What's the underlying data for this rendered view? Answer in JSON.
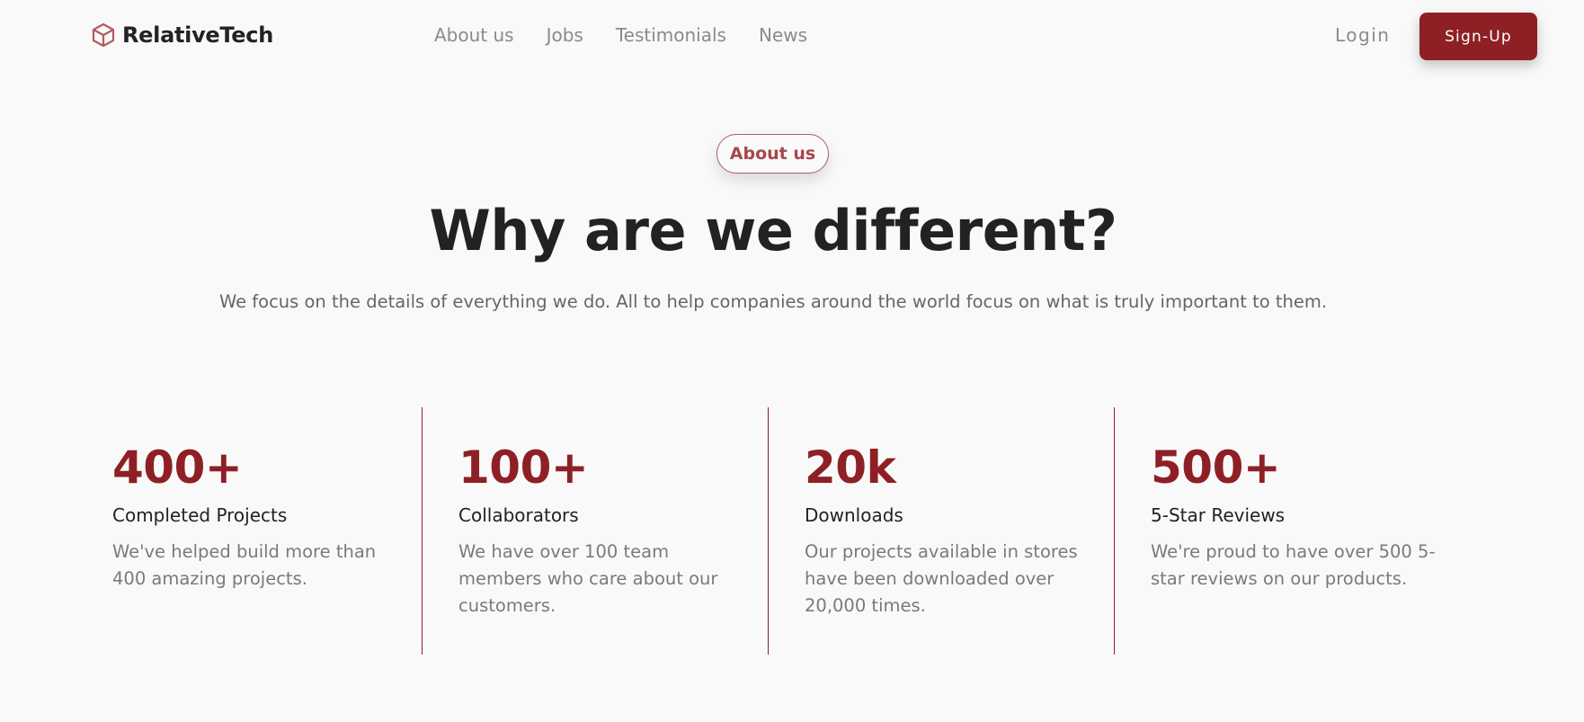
{
  "brand": {
    "name": "RelativeTech",
    "logo_icon": "cube-icon",
    "accent_color": "#8e2025"
  },
  "nav": {
    "links": [
      "About us",
      "Jobs",
      "Testimonials",
      "News"
    ],
    "login_label": "Login",
    "signup_label": "Sign-Up"
  },
  "hero": {
    "badge": "About us",
    "title": "Why are we different?",
    "subtitle": "We focus on the details of everything we do. All to help companies around the world focus on what is truly important to them."
  },
  "stats": [
    {
      "value": "400+",
      "label": "Completed Projects",
      "description": "We've helped build more than 400 amazing projects."
    },
    {
      "value": "100+",
      "label": "Collaborators",
      "description": "We have over 100 team members who care about our customers."
    },
    {
      "value": "20k",
      "label": "Downloads",
      "description": "Our projects available in stores have been downloaded over 20,000 times."
    },
    {
      "value": "500+",
      "label": "5-Star Reviews",
      "description": "We're proud to have over 500 5-star reviews on our products."
    }
  ]
}
